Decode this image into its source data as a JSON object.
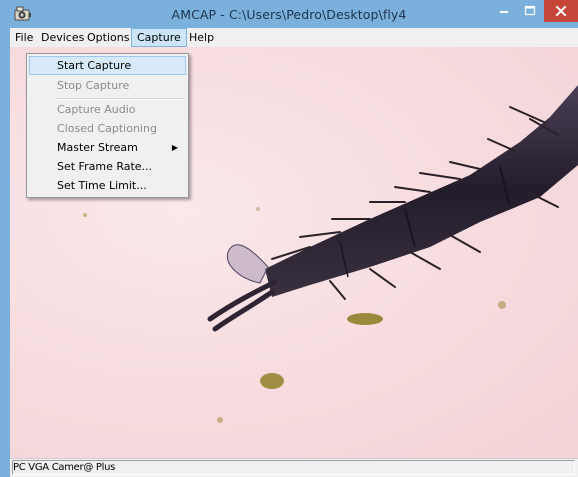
{
  "window": {
    "title": "AMCAP - C:\\Users\\Pedro\\Desktop\\fly4",
    "accent_color": "#7ab0db",
    "close_color": "#c7463a"
  },
  "menubar": {
    "items": [
      "File",
      "Devices",
      "Options",
      "Capture",
      "Help"
    ],
    "active": "Capture"
  },
  "capture_menu": {
    "items": [
      {
        "label": "Start Capture",
        "state": "highlighted"
      },
      {
        "label": "Stop Capture",
        "state": "disabled"
      },
      {
        "label": "Capture Audio",
        "state": "disabled"
      },
      {
        "label": "Closed Captioning",
        "state": "disabled"
      },
      {
        "label": "Master Stream",
        "state": "enabled",
        "submenu": true
      },
      {
        "label": "Set Frame Rate...",
        "state": "enabled"
      },
      {
        "label": "Set Time Limit...",
        "state": "enabled"
      }
    ]
  },
  "statusbar": {
    "text": "PC VGA Camer@ Plus"
  },
  "icons": {
    "app": "webcam-icon",
    "minimize": "minimize-icon",
    "maximize": "maximize-icon",
    "close": "close-icon",
    "submenu": "chevron-right-icon"
  }
}
